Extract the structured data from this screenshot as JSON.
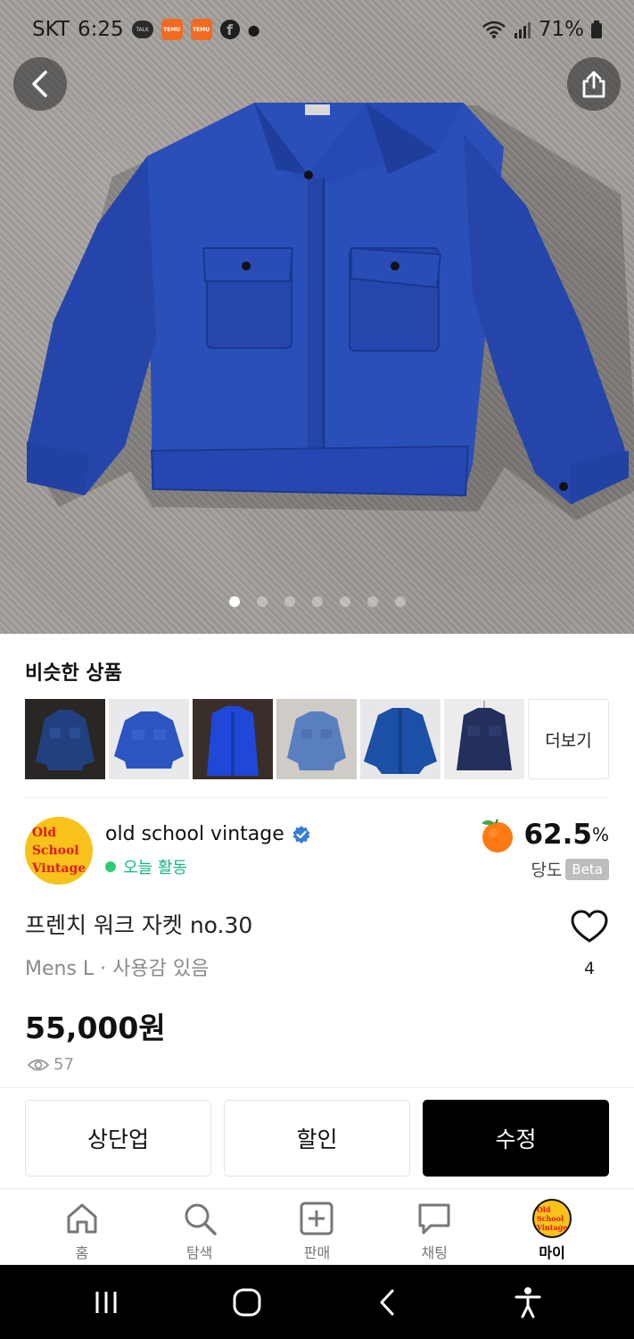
{
  "status_bar": {
    "carrier": "SKT",
    "time": "6:25",
    "battery": "71%",
    "app_badges": [
      "TALK",
      "TEMU",
      "TEMU"
    ]
  },
  "hero": {
    "image_count": 7,
    "active_index": 0,
    "image_desc": "blue-work-jacket"
  },
  "similar": {
    "title": "비슷한 상품",
    "more_label": "더보기",
    "thumbnails": [
      {
        "name": "navy-jacket-1",
        "color": "#22407f"
      },
      {
        "name": "blue-jacket-2",
        "color": "#2d55c2"
      },
      {
        "name": "blue-jacket-3",
        "color": "#1f48d8"
      },
      {
        "name": "denim-jacket-4",
        "color": "#4f72b0"
      },
      {
        "name": "blue-shirt-5",
        "color": "#1c4fa6"
      },
      {
        "name": "navy-jacket-6",
        "color": "#232f5c"
      }
    ]
  },
  "seller": {
    "name": "old school vintage",
    "avatar_text": [
      "Old",
      "School",
      "Vintage"
    ],
    "activity": "오늘 활동",
    "manner_value": "62.5",
    "manner_unit": "%",
    "manner_label": "당도",
    "beta_label": "Beta"
  },
  "product": {
    "title": "프렌치 워크 자켓 no.30",
    "meta": "Mens L · 사용감 있음",
    "price": "55,000원",
    "views": "57",
    "likes": "4"
  },
  "actions": {
    "bump": "상단업",
    "discount": "할인",
    "edit": "수정"
  },
  "nav": {
    "items": [
      {
        "label": "홈"
      },
      {
        "label": "탐색"
      },
      {
        "label": "판매"
      },
      {
        "label": "채팅"
      },
      {
        "label": "마이"
      }
    ]
  },
  "colors": {
    "accent_green": "#12b886",
    "avatar_yellow": "#f7c21a",
    "jacket_blue": "#2a4fb8"
  }
}
